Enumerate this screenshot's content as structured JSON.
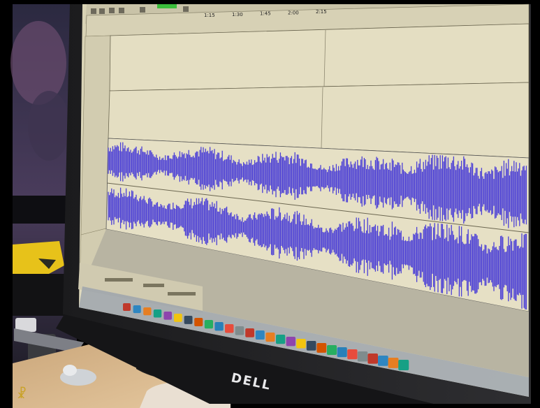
{
  "scene": {
    "monitor_brand": "DELL",
    "app": "audio-editor",
    "timeline_ticks": [
      "1:15",
      "1:30",
      "1:45",
      "2:00",
      "2:15"
    ],
    "waveform_color": "#4b3fd6",
    "track_bg_color": "#e3ddc0",
    "watermark_glyph": "☧"
  }
}
